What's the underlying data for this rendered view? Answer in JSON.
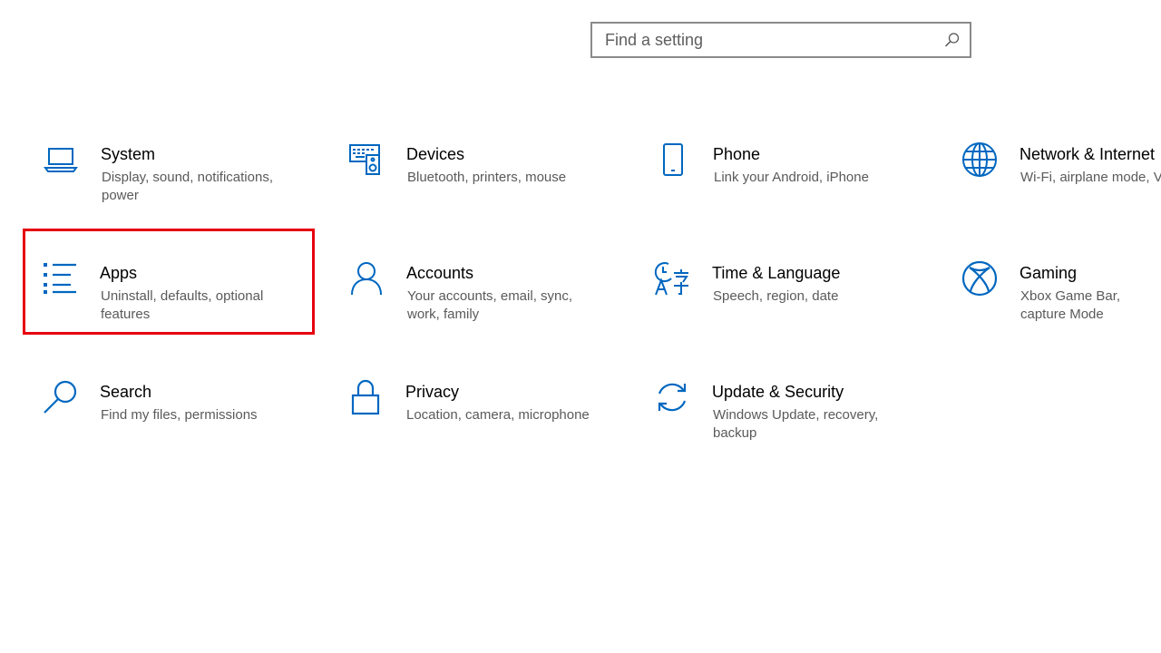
{
  "search": {
    "placeholder": "Find a setting",
    "icon": "search-icon"
  },
  "accent_color": "#0067c0",
  "highlight_color": "#e6000f",
  "tiles": [
    {
      "id": "system",
      "title": "System",
      "description": "Display, sound, notifications, power",
      "icon": "laptop-icon"
    },
    {
      "id": "devices",
      "title": "Devices",
      "description": "Bluetooth, printers, mouse",
      "icon": "keyboard-speaker-icon"
    },
    {
      "id": "phone",
      "title": "Phone",
      "description": "Link your Android, iPhone",
      "icon": "phone-icon"
    },
    {
      "id": "network",
      "title": "Network & Internet",
      "description": "Wi-Fi, airplane mode, V",
      "icon": "globe-icon"
    },
    {
      "id": "apps",
      "title": "Apps",
      "description": "Uninstall, defaults, optional features",
      "icon": "apps-list-icon",
      "highlighted": true
    },
    {
      "id": "accounts",
      "title": "Accounts",
      "description": "Your accounts, email, sync, work, family",
      "icon": "person-icon"
    },
    {
      "id": "time",
      "title": "Time & Language",
      "description": "Speech, region, date",
      "icon": "time-language-icon"
    },
    {
      "id": "gaming",
      "title": "Gaming",
      "description": "Xbox Game Bar, capture Mode",
      "icon": "xbox-icon"
    },
    {
      "id": "search",
      "title": "Search",
      "description": "Find my files, permissions",
      "icon": "magnifier-icon"
    },
    {
      "id": "privacy",
      "title": "Privacy",
      "description": "Location, camera, microphone",
      "icon": "lock-icon"
    },
    {
      "id": "update",
      "title": "Update & Security",
      "description": "Windows Update, recovery, backup",
      "icon": "sync-arrows-icon"
    }
  ]
}
